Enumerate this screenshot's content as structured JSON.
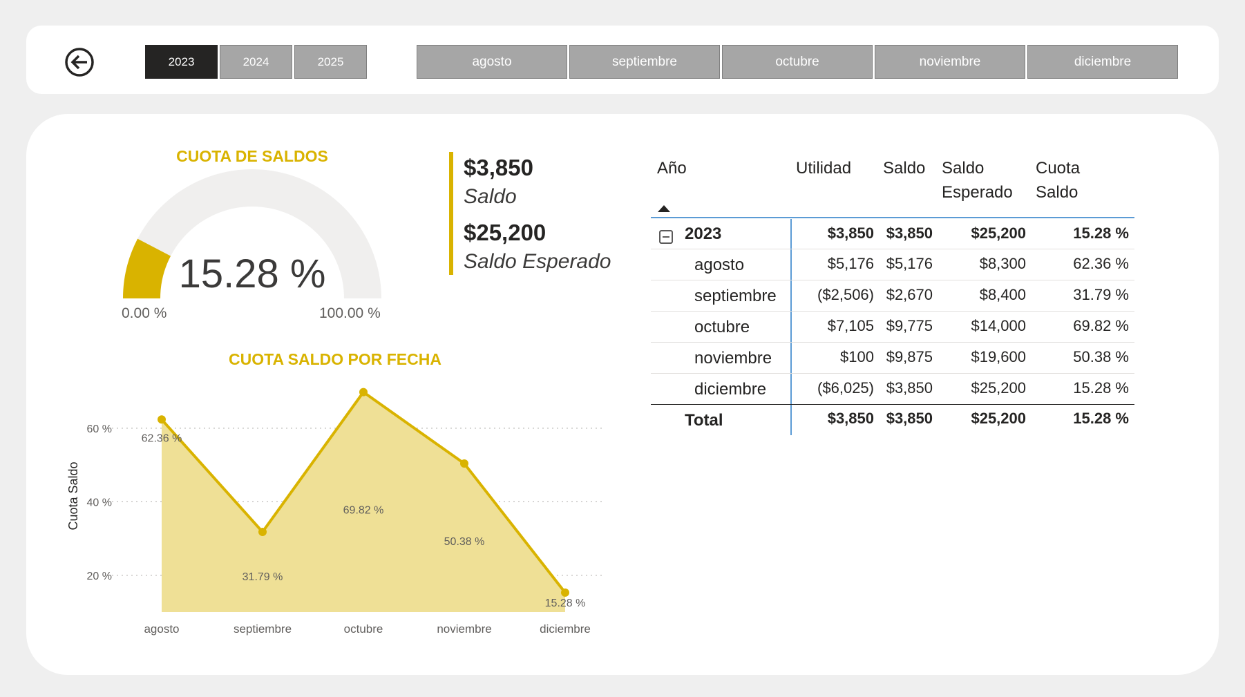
{
  "topbar": {
    "years": [
      {
        "label": "2023",
        "selected": true
      },
      {
        "label": "2024",
        "selected": false
      },
      {
        "label": "2025",
        "selected": false
      }
    ],
    "months": [
      "agosto",
      "septiembre",
      "octubre",
      "noviembre",
      "diciembre"
    ],
    "back_icon": "arrow-left-circle-icon"
  },
  "gauge": {
    "title": "CUOTA DE SALDOS",
    "value_label": "15.28 %",
    "value_fraction": 0.1528,
    "min_label": "0.00 %",
    "max_label": "100.00 %",
    "fill_color": "#d9b300",
    "track_color": "#f0efee"
  },
  "kpis": {
    "saldo_value": "$3,850",
    "saldo_label": "Saldo",
    "esperado_value": "$25,200",
    "esperado_label": "Saldo Esperado"
  },
  "chart_data": {
    "type": "area",
    "title": "CUOTA SALDO POR FECHA",
    "ylabel": "Cuota Saldo",
    "xlabel": "",
    "categories": [
      "agosto",
      "septiembre",
      "octubre",
      "noviembre",
      "diciembre"
    ],
    "values": [
      62.36,
      31.79,
      69.82,
      50.38,
      15.28
    ],
    "data_labels": [
      "62.36 %",
      "31.79 %",
      "69.82 %",
      "50.38 %",
      "15.28 %"
    ],
    "y_ticks": [
      "20 %",
      "40 %",
      "60 %"
    ],
    "ylim": [
      10,
      75
    ],
    "grid": "dotted horizontal",
    "line_color": "#d9b300",
    "fill_color": "#efe096"
  },
  "matrix": {
    "headers": {
      "year": "Año",
      "utilidad": "Utilidad",
      "saldo": "Saldo",
      "saldo_esperado_1": "Saldo",
      "saldo_esperado_2": "Esperado",
      "cuota_1": "Cuota",
      "cuota_2": "Saldo"
    },
    "sort_icon": "sort-ascending-icon",
    "collapse_icon": "minus-square-icon",
    "year_row": {
      "label": "2023",
      "utilidad": "$3,850",
      "saldo": "$3,850",
      "esperado": "$25,200",
      "cuota": "15.28 %"
    },
    "rows": [
      {
        "label": "agosto",
        "utilidad": "$5,176",
        "saldo": "$5,176",
        "esperado": "$8,300",
        "cuota": "62.36 %"
      },
      {
        "label": "septiembre",
        "utilidad": "($2,506)",
        "saldo": "$2,670",
        "esperado": "$8,400",
        "cuota": "31.79 %"
      },
      {
        "label": "octubre",
        "utilidad": "$7,105",
        "saldo": "$9,775",
        "esperado": "$14,000",
        "cuota": "69.82 %"
      },
      {
        "label": "noviembre",
        "utilidad": "$100",
        "saldo": "$9,875",
        "esperado": "$19,600",
        "cuota": "50.38 %"
      },
      {
        "label": "diciembre",
        "utilidad": "($6,025)",
        "saldo": "$3,850",
        "esperado": "$25,200",
        "cuota": "15.28 %"
      }
    ],
    "total_row": {
      "label": "Total",
      "utilidad": "$3,850",
      "saldo": "$3,850",
      "esperado": "$25,200",
      "cuota": "15.28 %"
    }
  }
}
